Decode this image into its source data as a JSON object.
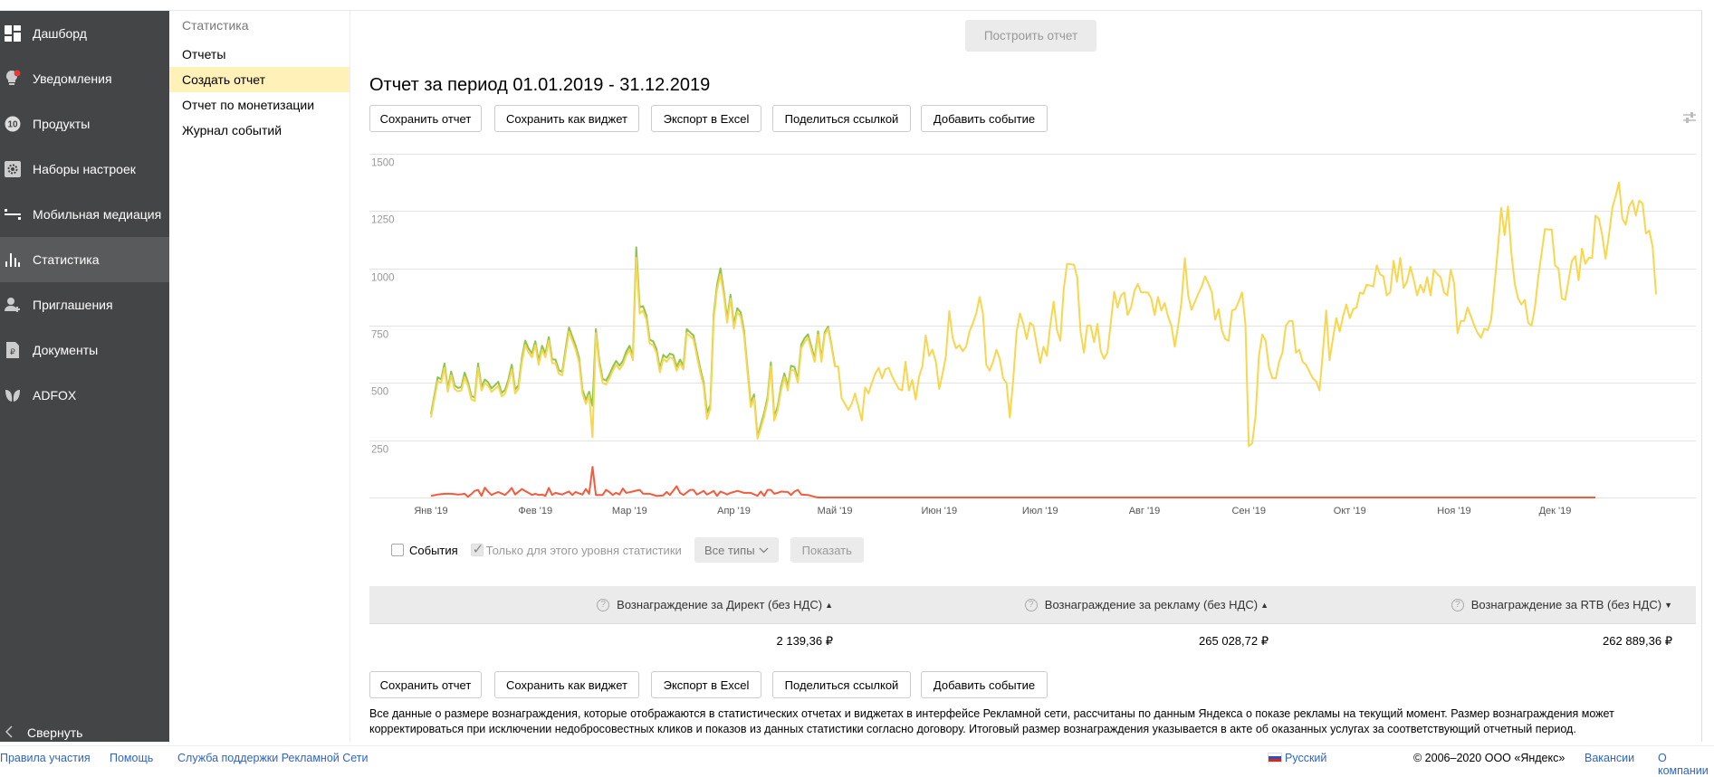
{
  "sidebar": {
    "items": [
      {
        "label": "Дашборд",
        "icon": "dashboard-icon"
      },
      {
        "label": "Уведомления",
        "icon": "bulb-notification-icon"
      },
      {
        "label": "Продукты",
        "icon": "products-10-icon",
        "badge": "10"
      },
      {
        "label": "Наборы настроек",
        "icon": "gear-icon"
      },
      {
        "label": "Мобильная медиация",
        "icon": "mediation-icon"
      },
      {
        "label": "Статистика",
        "icon": "bar-chart-icon",
        "active": true
      },
      {
        "label": "Приглашения",
        "icon": "user-add-icon"
      },
      {
        "label": "Документы",
        "icon": "document-ruble-icon"
      },
      {
        "label": "ADFOX",
        "icon": "adfox-leaf-icon"
      }
    ],
    "collapse_label": "Свернуть"
  },
  "submenu": {
    "title": "Статистика",
    "items": [
      "Отчеты",
      "Создать отчет",
      "Отчет по монетизации",
      "Журнал событий"
    ],
    "active_index": 1
  },
  "main": {
    "build_button": "Построить отчет",
    "title": "Отчет за период 01.01.2019 - 31.12.2019",
    "actions": [
      "Сохранить отчет",
      "Сохранить как виджет",
      "Экспорт в Excel",
      "Поделиться ссылкой",
      "Добавить событие"
    ],
    "filters": {
      "events_label": "События",
      "events_checked": false,
      "level_only_label": "Только для этого уровня статистики",
      "level_only_checked": true,
      "types_select": "Все типы",
      "show_button": "Показать"
    },
    "table": {
      "headers": [
        "Вознаграждение за Директ (без НДС)",
        "Вознаграждение за рекламу (без НДС)",
        "Вознаграждение за RTB (без НДС)"
      ],
      "sort": [
        "both",
        "both",
        "desc"
      ],
      "values": [
        "2 139,36 ₽",
        "265 028,72 ₽",
        "262 889,36 ₽"
      ]
    },
    "note_lines": [
      "Все данные о размере вознаграждения, которые отображаются в статистических отчетах и виджетах в интерфейсе Рекламной сети, рассчитаны по данным Яндекса о показе рекламы на текущий момент. Размер вознаграждения может",
      "корректироваться при исключении недобросовестных кликов и показов из данных статистики согласно договору. Итоговый размер вознаграждения указывается в акте об оказанных услугах за соответствующий отчетный период."
    ]
  },
  "footer": {
    "links_left": [
      "Правила участия",
      "Помощь",
      "Служба поддержки Рекламной Сети"
    ],
    "language": "Русский",
    "copyright": "© 2006–2020 ООО «Яндекс»",
    "links_right": [
      "Вакансии",
      "О компании"
    ]
  },
  "colors": {
    "sidebar": "#444547",
    "active_sub": "#fff1b8",
    "green": "#8cc54d",
    "yellow": "#f8d64e",
    "red": "#f55a3c",
    "link": "#2f64c0"
  },
  "chart_data": {
    "type": "line",
    "xlim": [
      "2019-01-01",
      "2019-12-31"
    ],
    "x_granularity": "day",
    "ylim": [
      0,
      1500
    ],
    "yticks": [
      250,
      500,
      750,
      1000,
      1250,
      1500
    ],
    "xtick_labels": [
      "Янв '19",
      "Фев '19",
      "Мар '19",
      "Апр '19",
      "Май '19",
      "Июн '19",
      "Июл '19",
      "Авг '19",
      "Сен '19",
      "Окт '19",
      "Ноя '19",
      "Дек '19"
    ],
    "grid": true,
    "legend": "none",
    "series": [
      {
        "color": "#8cc54d",
        "values": [
          364,
          445,
          525,
          515,
          585,
          476,
          550,
          490,
          478,
          482,
          545,
          502,
          443,
          436,
          585,
          482,
          515,
          502,
          476,
          490,
          505,
          456,
          470,
          515,
          580,
          470,
          490,
          610,
          685,
          650,
          628,
          682,
          596,
          662,
          628,
          700,
          602,
          602,
          556,
          548,
          650,
          742,
          702,
          662,
          610,
          470,
          426,
          462,
          400,
          735,
          596,
          518,
          510,
          536,
          570,
          596,
          575,
          596,
          636,
          662,
          615,
          1092,
          830,
          835,
          795,
          688,
          682,
          648,
          562,
          622,
          610,
          628,
          622,
          570,
          602,
          575,
          735,
          720,
          708,
          635,
          562,
          503,
          370,
          405,
          795,
          928,
          1000,
          900,
          780,
          885,
          755,
          826,
          808,
          728,
          570,
          412,
          450,
          265,
          318,
          370,
          438,
          590,
          352,
          398,
          484,
          542,
          484,
          575,
          570,
          516,
          668,
          695,
          712,
          660,
          606,
          725,
          604,
          722,
          746,
          666,
          578
        ]
      },
      {
        "color": "#f8d64e",
        "values": [
          349,
          430,
          507,
          500,
          566,
          461,
          533,
          474,
          463,
          467,
          526,
          487,
          428,
          421,
          566,
          467,
          500,
          487,
          461,
          474,
          487,
          441,
          454,
          500,
          559,
          454,
          474,
          592,
          665,
          632,
          612,
          665,
          579,
          645,
          612,
          684,
          586,
          586,
          540,
          533,
          632,
          724,
          684,
          645,
          592,
          454,
          408,
          447,
          263,
          717,
          579,
          500,
          493,
          520,
          553,
          579,
          559,
          579,
          618,
          645,
          599,
          1046,
          803,
          816,
          776,
          671,
          665,
          632,
          546,
          605,
          592,
          612,
          605,
          553,
          586,
          559,
          717,
          704,
          691,
          618,
          546,
          487,
          342,
          388,
          776,
          908,
          974,
          882,
          763,
          868,
          737,
          809,
          790,
          711,
          553,
          395,
          434,
          257,
          303,
          355,
          421,
          572,
          336,
          382,
          467,
          526,
          467,
          559,
          553,
          500,
          651,
          678,
          697,
          645,
          592,
          711,
          592,
          711,
          737,
          658,
          572,
          572,
          434,
          408,
          382,
          408,
          454,
          395,
          336,
          480,
          454,
          500,
          540,
          566,
          520,
          559,
          566,
          530,
          500,
          474,
          467,
          592,
          467,
          513,
          428,
          526,
          572,
          708,
          618,
          645,
          592,
          474,
          540,
          618,
          813,
          697,
          651,
          665,
          638,
          658,
          724,
          760,
          803,
          875,
          803,
          579,
          553,
          592,
          645,
          605,
          520,
          500,
          349,
          513,
          724,
          803,
          757,
          691,
          763,
          750,
          665,
          586,
          658,
          618,
          750,
          855,
          730,
          684,
          908,
          1020,
          1018,
          1016,
          961,
          724,
          632,
          750,
          750,
          678,
          757,
          638,
          605,
          632,
          763,
          898,
          829,
          882,
          895,
          796,
          829,
          901,
          932,
          895,
          895,
          895,
          869,
          796,
          875,
          816,
          849,
          790,
          750,
          658,
          750,
          855,
          1044,
          882,
          819,
          855,
          890,
          921,
          965,
          934,
          895,
          776,
          822,
          730,
          691,
          684,
          816,
          822,
          855,
          895,
          757,
          224,
          237,
          355,
          618,
          711,
          684,
          566,
          520,
          520,
          592,
          632,
          750,
          770,
          770,
          632,
          645,
          592,
          579,
          550,
          520,
          507,
          467,
          632,
          816,
          599,
          697,
          783,
          724,
          790,
          842,
          783,
          822,
          829,
          895,
          888,
          928,
          925,
          921,
          1013,
          974,
          965,
          882,
          895,
          1033,
          941,
          1046,
          915,
          941,
          1007,
          950,
          882,
          928,
          895,
          961,
          882,
          994,
          975,
          961,
          895,
          882,
          994,
          934,
          717,
          770,
          770,
          829,
          790,
          750,
          717,
          697,
          737,
          730,
          776,
          930,
          1086,
          1264,
          1145,
          1270,
          1066,
          934,
          869,
          842,
          862,
          763,
          750,
          829,
          961,
          1066,
          1171,
          1170,
          1169,
          1013,
          1000,
          869,
          862,
          948,
          1033,
          1053,
          948,
          1086,
          1020,
          1046,
          1046,
          1230,
          1217,
          1145,
          1042,
          1145,
          1263,
          1316,
          1375,
          1217,
          1191,
          1270,
          1296,
          1230,
          1296,
          1283,
          1152,
          1165,
          1092,
          886
        ]
      },
      {
        "color": "#f55a3c",
        "values": [
          7,
          10,
          13,
          15,
          16,
          16,
          16,
          15,
          13,
          14,
          16,
          3,
          15,
          29,
          33,
          7,
          43,
          25,
          11,
          18,
          24,
          17,
          11,
          25,
          42,
          13,
          25,
          37,
          28,
          20,
          11,
          16,
          11,
          13,
          7,
          42,
          11,
          20,
          16,
          13,
          20,
          26,
          11,
          24,
          18,
          13,
          37,
          16,
          134,
          11,
          11,
          11,
          33,
          24,
          11,
          20,
          13,
          39,
          20,
          23,
          26,
          30,
          33,
          17,
          16,
          16,
          12,
          7,
          8,
          9,
          24,
          11,
          30,
          49,
          20,
          11,
          22,
          33,
          33,
          13,
          20,
          29,
          13,
          20,
          29,
          7,
          26,
          20,
          13,
          20,
          24,
          29,
          25,
          20,
          20,
          20,
          14,
          7,
          26,
          7,
          33,
          33,
          16,
          20,
          26,
          25,
          24,
          11,
          26,
          33,
          13,
          12,
          11,
          7,
          3,
          0,
          0,
          0,
          0,
          0,
          0,
          0,
          0,
          0,
          0,
          0,
          0,
          0,
          0,
          0,
          0,
          0,
          0,
          0,
          0,
          0,
          0,
          0,
          0,
          0,
          0,
          0,
          0,
          0,
          0,
          0,
          0,
          0,
          0,
          0,
          0,
          0,
          0,
          0,
          0,
          0,
          0,
          0,
          0,
          0,
          0,
          0,
          0,
          0,
          0,
          0,
          0,
          0,
          0,
          0,
          0,
          0,
          0,
          0,
          0,
          0,
          0,
          0,
          0,
          0,
          0,
          0,
          0,
          0,
          0,
          0,
          0,
          0,
          0,
          0,
          0,
          0,
          0,
          0,
          0,
          0,
          0,
          0,
          0,
          0,
          0,
          0,
          0,
          0,
          0,
          0,
          0,
          0,
          0,
          0,
          0,
          0,
          0,
          0,
          0,
          0,
          0,
          0,
          0,
          0,
          0,
          0,
          0,
          0,
          0,
          0,
          0,
          0,
          0,
          0,
          0,
          0,
          0,
          0,
          0,
          0,
          0,
          0,
          0,
          0,
          0,
          0,
          0,
          0,
          0,
          0,
          0,
          0,
          0,
          0,
          0,
          0,
          0,
          0,
          0,
          0,
          0,
          0,
          0,
          0,
          0,
          0,
          0,
          0,
          0,
          0,
          0,
          0,
          0,
          0,
          0,
          0,
          0,
          0,
          0,
          0,
          0,
          0,
          0,
          0,
          0,
          0,
          0,
          0,
          0,
          0,
          0,
          0,
          0,
          0,
          0,
          0,
          0,
          0,
          0,
          0,
          0,
          0,
          0,
          0,
          0,
          0,
          0,
          0,
          0,
          0,
          0,
          0,
          0,
          0,
          0,
          0,
          0,
          0,
          0,
          0,
          0,
          0,
          0,
          0,
          0,
          0,
          0,
          0,
          0,
          0,
          0,
          0,
          0,
          0,
          0,
          0,
          0,
          0,
          0,
          0,
          0,
          0,
          0,
          0,
          0,
          0,
          0,
          0,
          0,
          0,
          0
        ]
      }
    ]
  }
}
